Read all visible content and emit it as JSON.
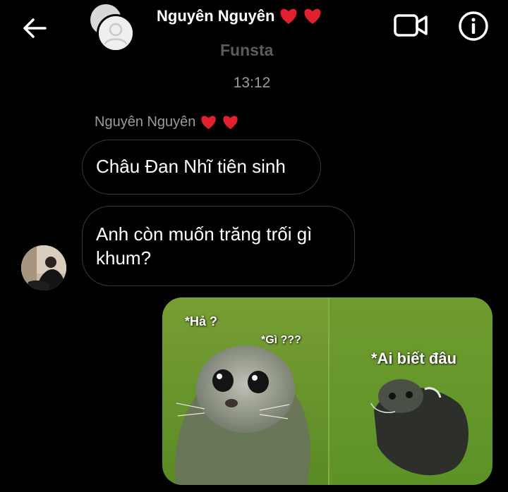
{
  "header": {
    "contact_name": "Nguyên Nguyên",
    "subtitle": "Funsta",
    "back_icon": "arrow-left-icon",
    "video_icon": "video-camera-icon",
    "info_icon": "info-icon",
    "name_emoji": "heart-icon"
  },
  "conversation": {
    "timestamp": "13:12",
    "sender_label": "Nguyên Nguyên",
    "messages": [
      {
        "text": "Châu Đan Nhĩ tiên sinh"
      },
      {
        "text": "Anh còn muốn trăng trối gì khum?"
      }
    ],
    "image_message": {
      "captions": [
        "*Hả ?",
        "*Gì ???",
        "*Ai biết đâu"
      ]
    }
  },
  "colors": {
    "background": "#000000",
    "bubble_border": "#3a3a3a",
    "muted_text": "#9b9b9b",
    "subtitle_text": "#5c5c5c",
    "heart": "#e0202e",
    "meme_water": "#6f9a2c"
  }
}
